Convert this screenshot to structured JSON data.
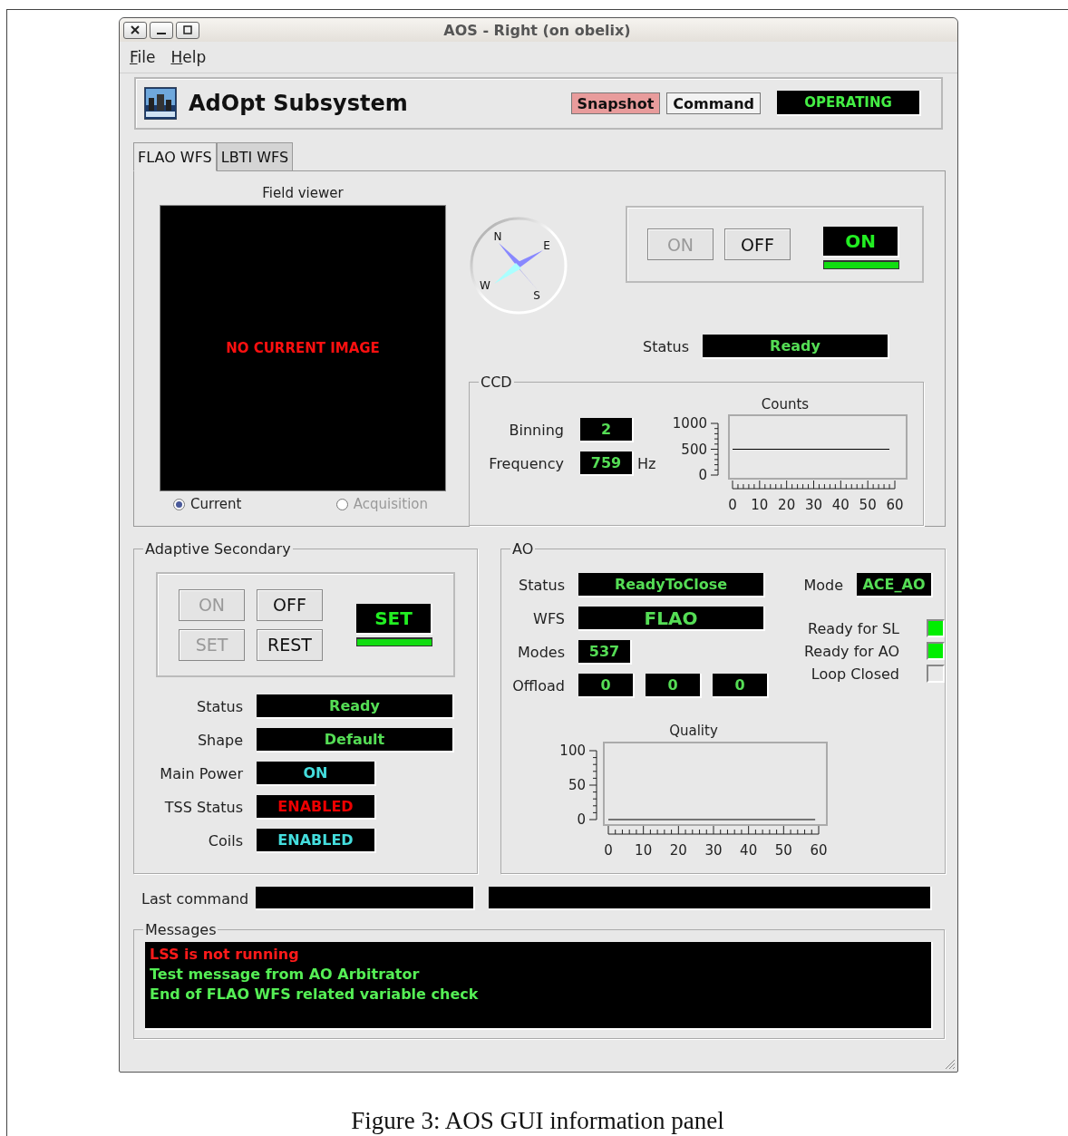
{
  "window": {
    "title": "AOS - Right (on obelix)"
  },
  "menu": [
    {
      "label": "File"
    },
    {
      "label": "Help"
    }
  ],
  "header": {
    "title": "AdOpt Subsystem",
    "buttons": [
      {
        "label": "Snapshot",
        "kind": "alert"
      },
      {
        "label": "Command",
        "kind": "plain"
      }
    ],
    "state": "OPERATING"
  },
  "tabs": [
    {
      "label": "FLAO WFS",
      "selected": true
    },
    {
      "label": "LBTI WFS",
      "selected": false
    }
  ],
  "field_viewer": {
    "title": "Field viewer",
    "message": "NO CURRENT IMAGE",
    "sources": [
      {
        "label": "Current",
        "selected": true,
        "disabled": false
      },
      {
        "label": "Acquisition",
        "selected": false,
        "disabled": true
      }
    ]
  },
  "compass": {
    "letters": [
      "N",
      "E",
      "W",
      "S"
    ]
  },
  "wfs_power": {
    "buttons": [
      {
        "label": "ON",
        "disabled": true
      },
      {
        "label": "OFF",
        "disabled": false
      }
    ],
    "lamp": {
      "label": "ON",
      "level": 1
    }
  },
  "wfs_status": {
    "label": "Status",
    "value": "Ready"
  },
  "ccd": {
    "title": "CCD",
    "fields": [
      {
        "label": "Binning",
        "value": "2"
      },
      {
        "label": "Frequency",
        "value": "759",
        "unit": "Hz"
      }
    ],
    "chart_data": {
      "type": "line",
      "title": "Counts",
      "x": [
        0,
        58
      ],
      "series": [
        {
          "color": "#000000",
          "values": [
            500,
            500
          ]
        }
      ],
      "xlim": [
        0,
        60
      ],
      "ylim": [
        0,
        1000
      ],
      "xticks": [
        0,
        10,
        20,
        30,
        40,
        50,
        60
      ],
      "yticks": [
        0,
        500,
        1000
      ]
    }
  },
  "adaptive_secondary": {
    "title": "Adaptive Secondary",
    "buttons": [
      {
        "label": "ON",
        "disabled": true
      },
      {
        "label": "OFF",
        "disabled": false
      },
      {
        "label": "SET",
        "disabled": true
      },
      {
        "label": "REST",
        "disabled": false
      }
    ],
    "lamp": {
      "label": "SET",
      "level": 1
    },
    "rows": [
      {
        "label": "Status",
        "value": "Ready",
        "color": "#55dd55",
        "kind": "wide"
      },
      {
        "label": "Shape",
        "value": "Default",
        "color": "#55dd55",
        "kind": "wide"
      },
      {
        "label": "Main Power",
        "value": "ON",
        "color": "#44dddd",
        "kind": "short"
      },
      {
        "label": "TSS Status",
        "value": "ENABLED",
        "color": "#ee0000",
        "kind": "short"
      },
      {
        "label": "Coils",
        "value": "ENABLED",
        "color": "#44dddd",
        "kind": "short"
      }
    ]
  },
  "ao": {
    "title": "AO",
    "rows": [
      {
        "label": "Status",
        "values": [
          "ReadyToClose"
        ],
        "kind": "wide"
      },
      {
        "label": "WFS",
        "values": [
          "FLAO"
        ],
        "kind": "large"
      },
      {
        "label": "Modes",
        "values": [
          "537"
        ],
        "kind": "short"
      },
      {
        "label": "Offload",
        "values": [
          "0",
          "0",
          "0"
        ],
        "kind": "short"
      }
    ],
    "mode": {
      "label": "Mode",
      "value": "ACE_AO"
    },
    "flags": [
      {
        "label": "Ready for SL",
        "checked": true
      },
      {
        "label": "Ready for AO",
        "checked": true
      },
      {
        "label": "Loop Closed",
        "checked": false
      }
    ],
    "chart_data": {
      "type": "line",
      "title": "Quality",
      "x": [
        0,
        59
      ],
      "series": [
        {
          "color": "#000000",
          "values": [
            0,
            0
          ]
        }
      ],
      "xlim": [
        0,
        60
      ],
      "ylim": [
        0,
        100
      ],
      "xticks": [
        0,
        10,
        20,
        30,
        40,
        50,
        60
      ],
      "yticks": [
        0,
        50,
        100
      ]
    }
  },
  "last_command": {
    "label": "Last command"
  },
  "messages": {
    "title": "Messages",
    "lines": [
      {
        "text": "LSS is not running",
        "color": "#ff1a1a"
      },
      {
        "text": "Test message from AO Arbitrator",
        "color": "#55ee55"
      },
      {
        "text": "End of FLAO WFS related variable check",
        "color": "#55ee55"
      }
    ]
  },
  "caption": "Figure 3: AOS GUI information panel"
}
